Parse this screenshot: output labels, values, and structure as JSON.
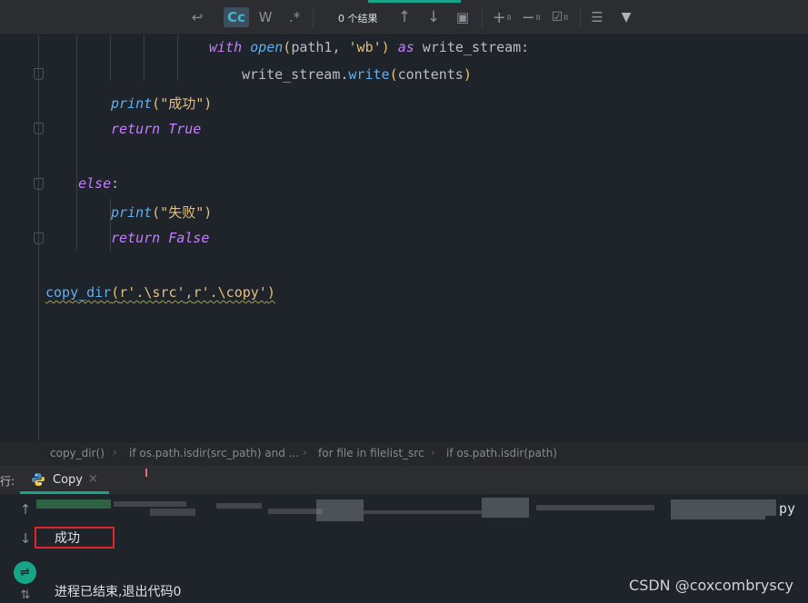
{
  "toolbar": {
    "buttons": [
      {
        "id": "replace",
        "icon": "replace-icon",
        "glyph": "↩"
      },
      {
        "id": "match-case",
        "label": "Cc",
        "active": true
      },
      {
        "id": "words",
        "label": "W"
      },
      {
        "id": "regex",
        "label": ".*"
      }
    ],
    "results_text": "0 个结果",
    "nav_up_glyph": "↑",
    "nav_down_glyph": "↓",
    "select_all_glyph": "▣",
    "add_selection_glyph": "+",
    "remove_selection_glyph": "−",
    "select_all_occ_glyph": "☑",
    "filter_opts_glyph": "☰",
    "filter_glyph": "▼",
    "sub_label": "II"
  },
  "editor": {
    "line1": {
      "kw1": "with",
      "fn": "open",
      "p1": "(",
      "a": "path1, ",
      "s": "'wb'",
      "p2": ")",
      "kw2": " as",
      "rest": " write_stream:"
    },
    "line2": {
      "obj": "write_stream.",
      "fn": "write",
      "p1": "(",
      "arg": "contents",
      "p2": ")"
    },
    "line3": {
      "fn": "print",
      "p1": "(",
      "s": "\"成功\"",
      "p2": ")"
    },
    "line4": {
      "kw": "return",
      "val": " True"
    },
    "line5": {
      "kw": "else",
      "colon": ":"
    },
    "line6": {
      "fn": "print",
      "p1": "(",
      "s": "\"失败\"",
      "p2": ")"
    },
    "line7": {
      "kw": "return",
      "val": " False"
    },
    "line8": {
      "fn": "copy_dir",
      "p1": "(",
      "s1": "r'.\\src'",
      "c": ",",
      "s2": "r'.\\copy'",
      "p2": ")"
    }
  },
  "breadcrumbs": [
    "copy_dir()",
    "if os.path.isdir(src_path) and ...",
    "for file in filelist_src",
    "if os.path.isdir(path)"
  ],
  "breadcrumb_sep": "›",
  "run": {
    "label": "行:",
    "tab_name": "Copy",
    "tab_close": "×"
  },
  "console": {
    "gutter_up": "↑",
    "gutter_down": "↓",
    "wrap_glyph": "⇌",
    "sort_glyph": "⇅",
    "line_tail": "py",
    "output_line": "成功",
    "exit_line": "进程已结束,退出代码0"
  },
  "watermark": "CSDN @coxcombryscy"
}
